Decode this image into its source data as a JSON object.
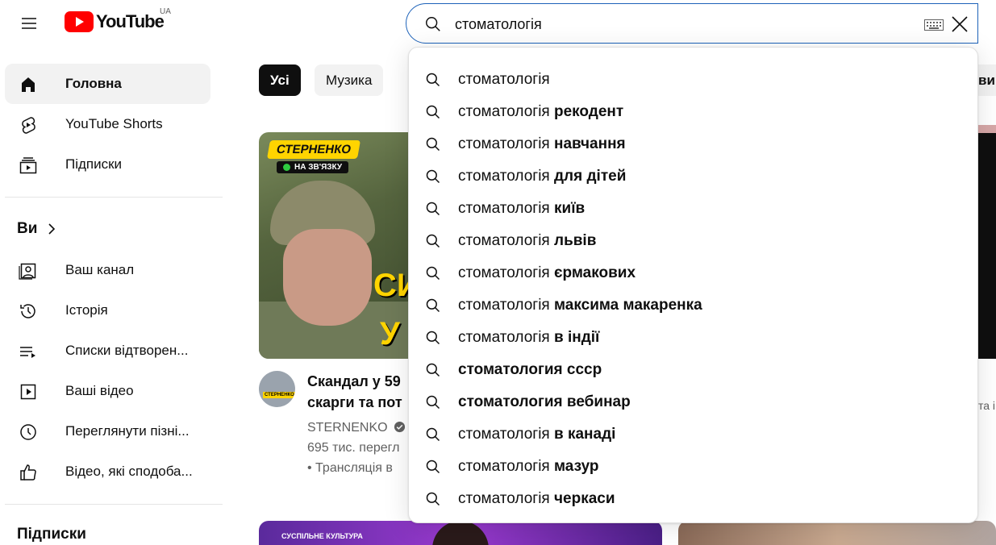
{
  "masthead": {
    "logo_text": "YouTube",
    "region": "UA",
    "search_value": "стоматологія"
  },
  "sidebar": {
    "main": [
      {
        "label": "Головна",
        "icon": "home-icon",
        "active": true
      },
      {
        "label": "YouTube Shorts",
        "icon": "shorts-icon"
      },
      {
        "label": "Підписки",
        "icon": "subscriptions-icon"
      }
    ],
    "you_heading": "Ви",
    "you_items": [
      {
        "label": "Ваш канал",
        "icon": "channel-icon"
      },
      {
        "label": "Історія",
        "icon": "history-icon"
      },
      {
        "label": "Списки відтворен...",
        "icon": "playlist-icon"
      },
      {
        "label": "Ваші відео",
        "icon": "your-videos-icon"
      },
      {
        "label": "Переглянути пізні...",
        "icon": "watch-later-icon"
      },
      {
        "label": "Відео, які сподоба...",
        "icon": "liked-icon"
      }
    ],
    "subs_heading": "Підписки"
  },
  "chips": [
    {
      "label": "Усі",
      "active": true
    },
    {
      "label": "Музика"
    }
  ],
  "chip_right_partial": "ви",
  "video1": {
    "badge": "СТЕРНЕНКО",
    "live_text": "НА ЗВ'ЯЗКУ",
    "overlay_line1": "СИ",
    "overlay_line2": "У",
    "avatar_label": "СТЕРНЕНКО",
    "title_line1": "Скандал у 59",
    "title_line2": "скарги та пот",
    "channel": "STERNENKO",
    "views": "695 тис. перегл",
    "stream": "• Трансляція в"
  },
  "right_meta_partial": "та і",
  "bottom_thumb_label": "СУСПІЛЬНЕ КУЛЬТУРА",
  "suggestions": [
    {
      "prefix": "стоматологія",
      "suffix": ""
    },
    {
      "prefix": "стоматологія",
      "suffix": "рекодент"
    },
    {
      "prefix": "стоматологія",
      "suffix": "навчання"
    },
    {
      "prefix": "стоматологія",
      "suffix": "для дітей"
    },
    {
      "prefix": "стоматологія",
      "suffix": "київ"
    },
    {
      "prefix": "стоматологія",
      "suffix": "львів"
    },
    {
      "prefix": "стоматологія",
      "suffix": "єрмакових"
    },
    {
      "prefix": "стоматологія",
      "suffix": "максима макаренка"
    },
    {
      "prefix": "стоматологія",
      "suffix": "в індії"
    },
    {
      "prefix": "",
      "suffix": "стоматология ссср"
    },
    {
      "prefix": "",
      "suffix": "стоматология вебинар"
    },
    {
      "prefix": "стоматологія",
      "suffix": "в канаді"
    },
    {
      "prefix": "стоматологія",
      "suffix": "мазур"
    },
    {
      "prefix": "стоматологія",
      "suffix": "черкаси"
    }
  ]
}
